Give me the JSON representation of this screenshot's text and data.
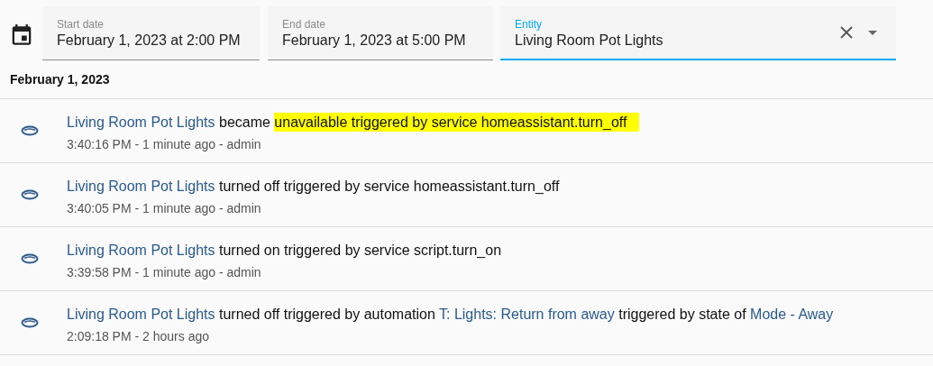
{
  "filters": {
    "start_date": {
      "label": "Start date",
      "value": "February 1, 2023 at 2:00 PM"
    },
    "end_date": {
      "label": "End date",
      "value": "February 1, 2023 at 5:00 PM"
    },
    "entity": {
      "label": "Entity",
      "value": "Living Room Pot Lights",
      "focused": true
    }
  },
  "date_heading": "February 1, 2023",
  "entries": [
    {
      "message": [
        {
          "kind": "link",
          "text": "Living Room Pot Lights"
        },
        {
          "kind": "text",
          "text": " became "
        },
        {
          "kind": "highlight",
          "text": "unavailable triggered by service homeassistant.turn_off"
        }
      ],
      "meta": "3:40:16 PM - 1 minute ago - admin"
    },
    {
      "message": [
        {
          "kind": "link",
          "text": "Living Room Pot Lights"
        },
        {
          "kind": "text",
          "text": " turned off triggered by service homeassistant.turn_off"
        }
      ],
      "meta": "3:40:05 PM - 1 minute ago - admin"
    },
    {
      "message": [
        {
          "kind": "link",
          "text": "Living Room Pot Lights"
        },
        {
          "kind": "text",
          "text": " turned on triggered by service script.turn_on"
        }
      ],
      "meta": "3:39:58 PM - 1 minute ago - admin"
    },
    {
      "message": [
        {
          "kind": "link",
          "text": "Living Room Pot Lights"
        },
        {
          "kind": "text",
          "text": " turned off triggered by automation "
        },
        {
          "kind": "link",
          "text": "T: Lights: Return from away"
        },
        {
          "kind": "text",
          "text": " triggered by state of "
        },
        {
          "kind": "link",
          "text": "Mode - Away"
        }
      ],
      "meta": "2:09:18 PM - 2 hours ago"
    }
  ]
}
